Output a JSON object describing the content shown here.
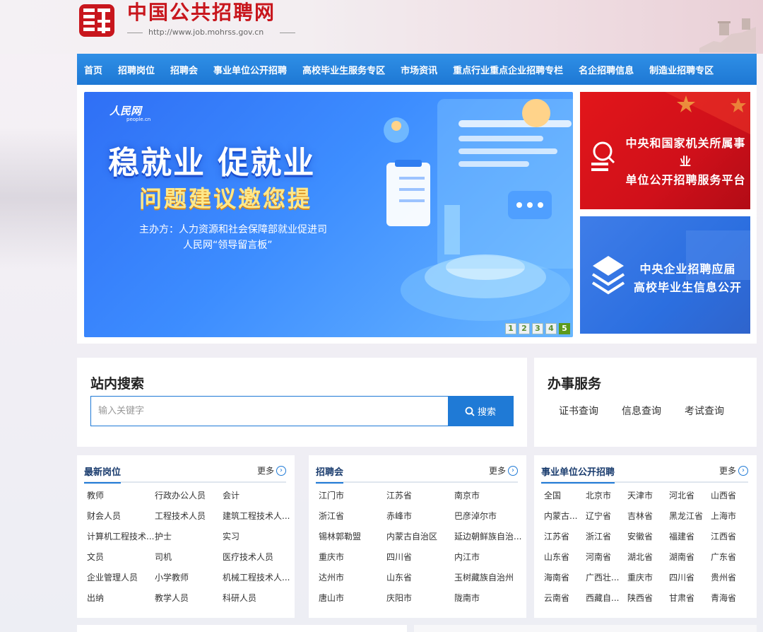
{
  "header": {
    "site_name": "中国公共招聘网",
    "site_url": "http://www.job.mohrss.gov.cn"
  },
  "nav": {
    "items": [
      "首页",
      "招聘岗位",
      "招聘会",
      "事业单位公开招聘",
      "高校毕业生服务专区",
      "市场资讯",
      "重点行业重点企业招聘专栏",
      "名企招聘信息",
      "制造业招聘专区"
    ]
  },
  "banner": {
    "brand": "人民网",
    "brand_sub": "people.cn",
    "title_line1": "稳就业 促就业",
    "title_line2": "问题建议邀您提",
    "sub_line1": "主办方：人力资源和社会保障部就业促进司",
    "sub_line2": "人民网“领导留言板”",
    "pages": [
      "1",
      "2",
      "3",
      "4",
      "5"
    ],
    "active_page": "5"
  },
  "side_banners": {
    "red_line1": "中央和国家机关所属事业",
    "red_line2": "单位公开招聘服务平台",
    "blue_line1": "中央企业招聘应届",
    "blue_line2": "高校毕业生信息公开"
  },
  "search": {
    "title": "站内搜索",
    "placeholder": "输入关键字",
    "button_label": "搜索"
  },
  "services": {
    "title": "办事服务",
    "items": [
      "证书查询",
      "信息查询",
      "考试查询"
    ]
  },
  "latest_jobs": {
    "title": "最新岗位",
    "more": "更多",
    "items": [
      "教师",
      "行政办公人员",
      "会计",
      "财会人员",
      "工程技术人员",
      "建筑工程技术人...",
      "计算机工程技术...",
      "护士",
      "实习",
      "文员",
      "司机",
      "医疗技术人员",
      "企业管理人员",
      "小学教师",
      "机械工程技术人...",
      "出纳",
      "教学人员",
      "科研人员"
    ]
  },
  "job_fairs": {
    "title": "招聘会",
    "more": "更多",
    "items": [
      "江门市",
      "江苏省",
      "南京市",
      "浙江省",
      "赤峰市",
      "巴彦淖尔市",
      "锡林郭勒盟",
      "内蒙古自治区",
      "延边朝鲜族自治...",
      "重庆市",
      "四川省",
      "内江市",
      "达州市",
      "山东省",
      "玉树藏族自治州",
      "唐山市",
      "庆阳市",
      "陇南市"
    ]
  },
  "public_institutions": {
    "title": "事业单位公开招聘",
    "more": "更多",
    "items": [
      "全国",
      "北京市",
      "天津市",
      "河北省",
      "山西省",
      "内蒙古...",
      "辽宁省",
      "吉林省",
      "黑龙江省",
      "上海市",
      "江苏省",
      "浙江省",
      "安徽省",
      "福建省",
      "江西省",
      "山东省",
      "河南省",
      "湖北省",
      "湖南省",
      "广东省",
      "海南省",
      "广西壮...",
      "重庆市",
      "四川省",
      "贵州省",
      "云南省",
      "西藏自...",
      "陕西省",
      "甘肃省",
      "青海省"
    ]
  },
  "colors": {
    "brand_red": "#c8161d",
    "nav_blue": "#1e78d4",
    "accent_blue": "#1f7ad6",
    "active_page_green": "#5c9a1c"
  }
}
